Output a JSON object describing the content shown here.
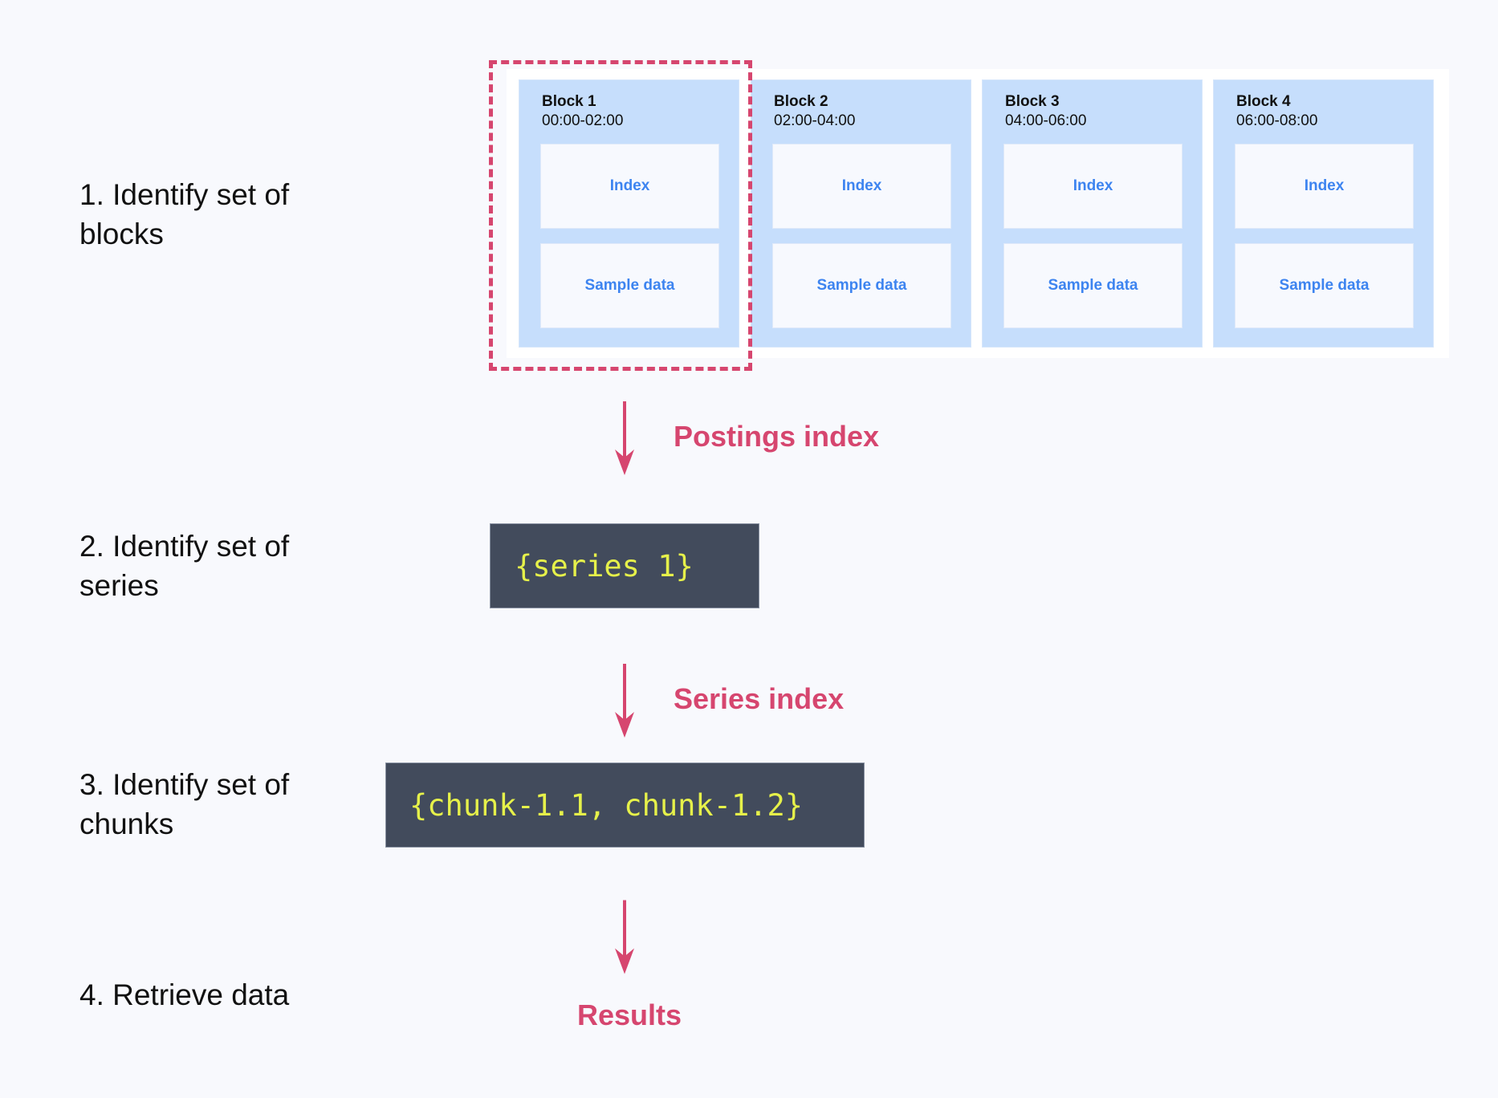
{
  "steps": [
    {
      "label": "1. Identify set of blocks"
    },
    {
      "label": "2. Identify set of series"
    },
    {
      "label": "3. Identify set of chunks"
    },
    {
      "label": "4. Retrieve data"
    }
  ],
  "blocks": [
    {
      "title": "Block 1",
      "time": "00:00-02:00",
      "index": "Index",
      "sample": "Sample data",
      "selected": true
    },
    {
      "title": "Block 2",
      "time": "02:00-04:00",
      "index": "Index",
      "sample": "Sample data",
      "selected": false
    },
    {
      "title": "Block 3",
      "time": "04:00-06:00",
      "index": "Index",
      "sample": "Sample data",
      "selected": false
    },
    {
      "title": "Block 4",
      "time": "06:00-08:00",
      "index": "Index",
      "sample": "Sample data",
      "selected": false
    }
  ],
  "flow": {
    "postings_label": "Postings index",
    "series_set": "{series 1}",
    "series_label": "Series index",
    "chunk_set": "{chunk-1.1, chunk-1.2}",
    "results_label": "Results"
  },
  "colors": {
    "accent": "#d6466f",
    "block_bg": "#c6defc",
    "inner_text": "#3d84f0",
    "code_bg": "#424b5c",
    "code_text": "#e6f14a",
    "page_bg": "#f8f9fd"
  }
}
